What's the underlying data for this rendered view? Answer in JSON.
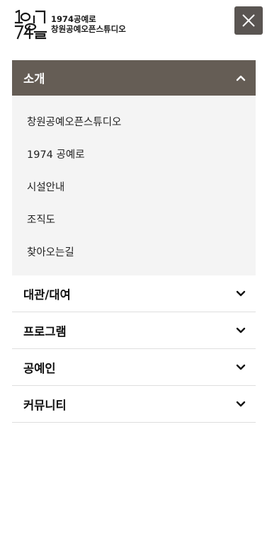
{
  "header": {
    "logo_numerals": "1974",
    "logo_line1": "1974공예로",
    "logo_line2": "창원공예오픈스튜디오",
    "close_icon": "close-icon"
  },
  "menu": {
    "active_section": {
      "label": "소개",
      "icon": "chevron-up-icon",
      "items": [
        {
          "label": "창원공예오픈스튜디오"
        },
        {
          "label": "1974 공예로"
        },
        {
          "label": "시설안내"
        },
        {
          "label": "조직도"
        },
        {
          "label": "찾아오는길"
        }
      ]
    },
    "sections": [
      {
        "label": "대관/대여",
        "icon": "chevron-down-icon"
      },
      {
        "label": "프로그램",
        "icon": "chevron-down-icon"
      },
      {
        "label": "공예인",
        "icon": "chevron-down-icon"
      },
      {
        "label": "커뮤니티",
        "icon": "chevron-down-icon"
      }
    ]
  },
  "colors": {
    "accent": "#655d55",
    "close_button": "#5a5552",
    "submenu_bg": "#f4f4f4",
    "divider": "#dedede"
  }
}
